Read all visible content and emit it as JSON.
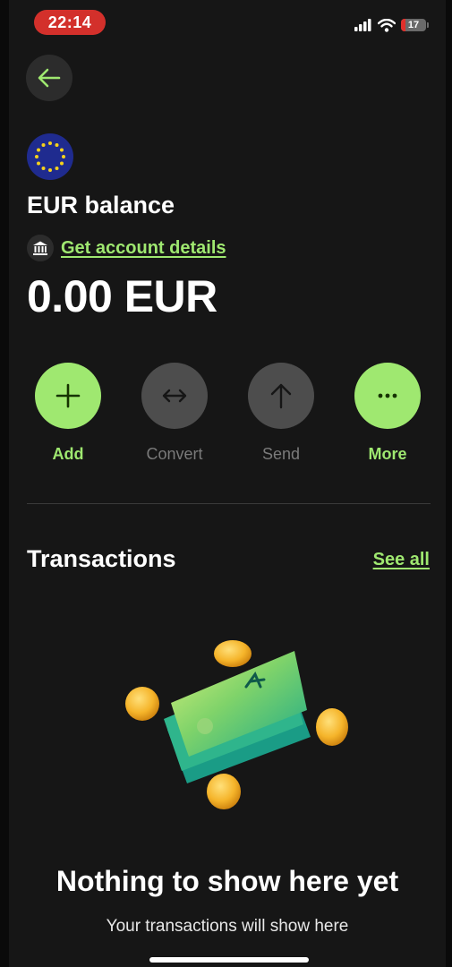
{
  "status_bar": {
    "time": "22:14",
    "battery": "17",
    "battery_level_percent": 17
  },
  "header": {
    "title": "EUR balance",
    "account_details_link": "Get account details",
    "balance": "0.00 EUR"
  },
  "actions": [
    {
      "label": "Add",
      "icon": "plus-icon",
      "enabled": true
    },
    {
      "label": "Convert",
      "icon": "convert-arrows-icon",
      "enabled": false
    },
    {
      "label": "Send",
      "icon": "arrow-up-icon",
      "enabled": false
    },
    {
      "label": "More",
      "icon": "more-dots-icon",
      "enabled": true
    }
  ],
  "transactions": {
    "title": "Transactions",
    "see_all": "See all",
    "empty_title": "Nothing to show here yet",
    "empty_subtitle": "Your transactions will show here"
  },
  "colors": {
    "accent": "#9fe870",
    "background": "#161616",
    "button_disabled": "#4d4d4d",
    "disabled_text": "#7a7a7a",
    "time_badge": "#d3302b"
  }
}
